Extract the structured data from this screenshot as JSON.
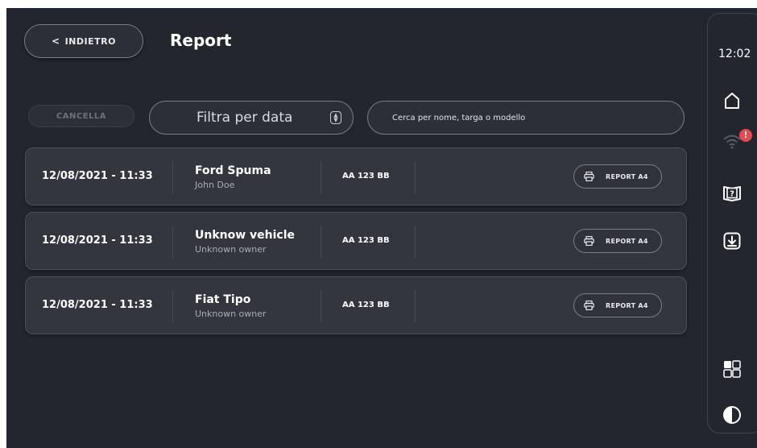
{
  "header": {
    "back_label": "INDIETRO",
    "title": "Report"
  },
  "filters": {
    "cancel_label": "CANCELLA",
    "date_filter_label": "Filtra per data",
    "search_placeholder": "Cerca per nome, targa o modello",
    "search_value": ""
  },
  "reports": [
    {
      "datetime": "12/08/2021 - 11:33",
      "vehicle": "Ford Spuma",
      "owner": "John Doe",
      "plate": "AA 123 BB",
      "action_label": "REPORT A4"
    },
    {
      "datetime": "12/08/2021 - 11:33",
      "vehicle": "Unknow vehicle",
      "owner": "Unknown owner",
      "plate": "AA 123 BB",
      "action_label": "REPORT A4"
    },
    {
      "datetime": "12/08/2021 - 11:33",
      "vehicle": "Fiat Tipo",
      "owner": "Unknown owner",
      "plate": "AA 123 BB",
      "action_label": "REPORT A4"
    }
  ],
  "sidebar": {
    "time": "12:02",
    "alert_badge": "!",
    "icons": [
      "home-icon",
      "wifi-icon",
      "help-book-icon",
      "download-icon",
      "apps-grid-icon",
      "theme-contrast-icon"
    ]
  },
  "colors": {
    "background": "#23262f",
    "card": "#33363f",
    "border": "#7a7e88",
    "alert": "#e8474c"
  }
}
